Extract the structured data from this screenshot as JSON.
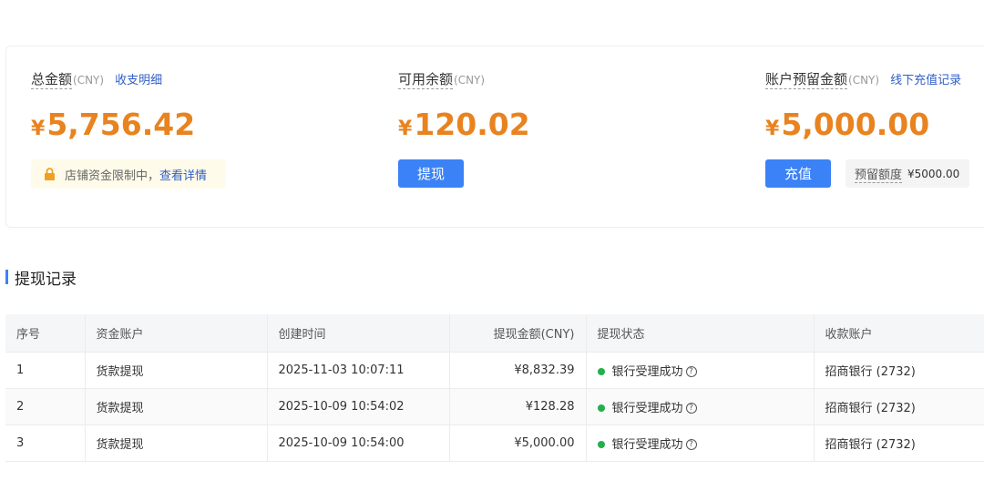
{
  "summary": {
    "total": {
      "label": "总金额",
      "unit": "(CNY)",
      "link": "收支明细",
      "currency": "¥",
      "amount": "5,756.42",
      "notice_text": "店铺资金限制中，",
      "notice_link": "查看详情"
    },
    "available": {
      "label": "可用余额",
      "unit": "(CNY)",
      "currency": "¥",
      "amount": "120.02",
      "button": "提现"
    },
    "reserved": {
      "label": "账户预留金额",
      "unit": "(CNY)",
      "link": "线下充值记录",
      "currency": "¥",
      "amount": "5,000.00",
      "button": "充值",
      "quota_label": "预留额度",
      "quota_value": "¥5000.00"
    }
  },
  "section": {
    "title": "提现记录"
  },
  "table": {
    "headers": [
      "序号",
      "资金账户",
      "创建时间",
      "提现金额(CNY)",
      "提现状态",
      "收款账户"
    ],
    "rows": [
      {
        "index": "1",
        "account": "货款提现",
        "created": "2025-11-03 10:07:11",
        "amount": "¥8,832.39",
        "status": "银行受理成功",
        "payee": "招商银行 (2732)"
      },
      {
        "index": "2",
        "account": "货款提现",
        "created": "2025-10-09 10:54:02",
        "amount": "¥128.28",
        "status": "银行受理成功",
        "payee": "招商银行 (2732)"
      },
      {
        "index": "3",
        "account": "货款提现",
        "created": "2025-10-09 10:54:00",
        "amount": "¥5,000.00",
        "status": "银行受理成功",
        "payee": "招商银行 (2732)"
      }
    ]
  },
  "icons": {
    "lock": "lock-icon",
    "help": "help-circle-icon",
    "status": "status-dot-icon"
  },
  "colors": {
    "amount": "#e8831f",
    "link": "#2f5ec8",
    "primary_button": "#3b82f6",
    "success": "#22b04b"
  }
}
